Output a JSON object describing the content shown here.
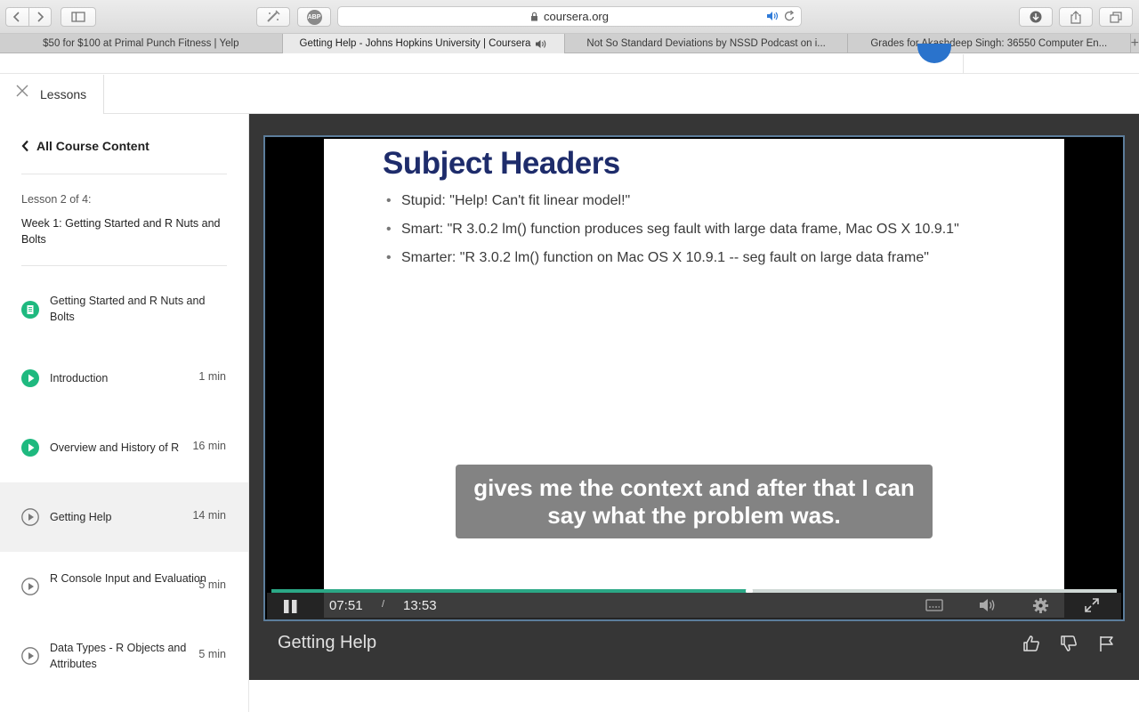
{
  "browser": {
    "url": "coursera.org",
    "tabs": [
      {
        "title": "$50 for $100 at Primal Punch Fitness | Yelp",
        "active": false
      },
      {
        "title": "Getting Help - Johns Hopkins University | Coursera",
        "active": true
      },
      {
        "title": "Not So Standard Deviations by NSSD Podcast on i...",
        "active": false
      },
      {
        "title": "Grades for Akashdeep Singh: 36550 Computer En...",
        "active": false
      }
    ],
    "icons": [
      "back-icon",
      "forward-icon",
      "sidebar-icon",
      "extension-icon",
      "adblock-icon",
      "lock-icon",
      "speaker-icon",
      "reload-icon",
      "download-icon",
      "share-icon",
      "tabs-icon",
      "new-tab-icon"
    ],
    "adblock_label": "ABP"
  },
  "lessons_tab": {
    "label": "Lessons"
  },
  "sidebar": {
    "back_label": "All Course Content",
    "lesson_count": "Lesson 2 of 4:",
    "lesson_title": "Week 1: Getting Started and R Nuts and Bolts",
    "items": [
      {
        "title": "Getting Started and R Nuts and Bolts",
        "duration": "",
        "icon": "reading-icon",
        "state": "completed"
      },
      {
        "title": "Introduction",
        "duration": "1 min",
        "icon": "play-icon",
        "state": "completed"
      },
      {
        "title": "Overview and History of R",
        "duration": "16 min",
        "icon": "play-icon",
        "state": "completed"
      },
      {
        "title": "Getting Help",
        "duration": "14 min",
        "icon": "play-icon",
        "state": "current"
      },
      {
        "title": "R Console Input and Evaluation",
        "duration": "5 min",
        "icon": "play-icon",
        "state": "pending"
      },
      {
        "title": "Data Types - R Objects and Attributes",
        "duration": "5 min",
        "icon": "play-icon",
        "state": "pending"
      }
    ]
  },
  "video": {
    "slide_title": "Subject Headers",
    "bullets": [
      "Stupid: \"Help! Can't fit linear model!\"",
      "Smart: \"R 3.0.2 lm() function produces seg fault with large data frame, Mac OS X 10.9.1\"",
      "Smarter: \"R 3.0.2 lm() function on Mac OS X 10.9.1 -- seg fault on large data frame\""
    ],
    "caption_line1": "gives me the context and after that I can",
    "caption_line2": "say what the problem was.",
    "current_time": "07:51",
    "separator": "/",
    "total_time": "13:53",
    "progress_fraction": 0.565,
    "accent_color": "#2ba886"
  },
  "below": {
    "title": "Getting Help",
    "actions": [
      "thumbs-up-icon",
      "thumbs-down-icon",
      "flag-icon"
    ]
  }
}
